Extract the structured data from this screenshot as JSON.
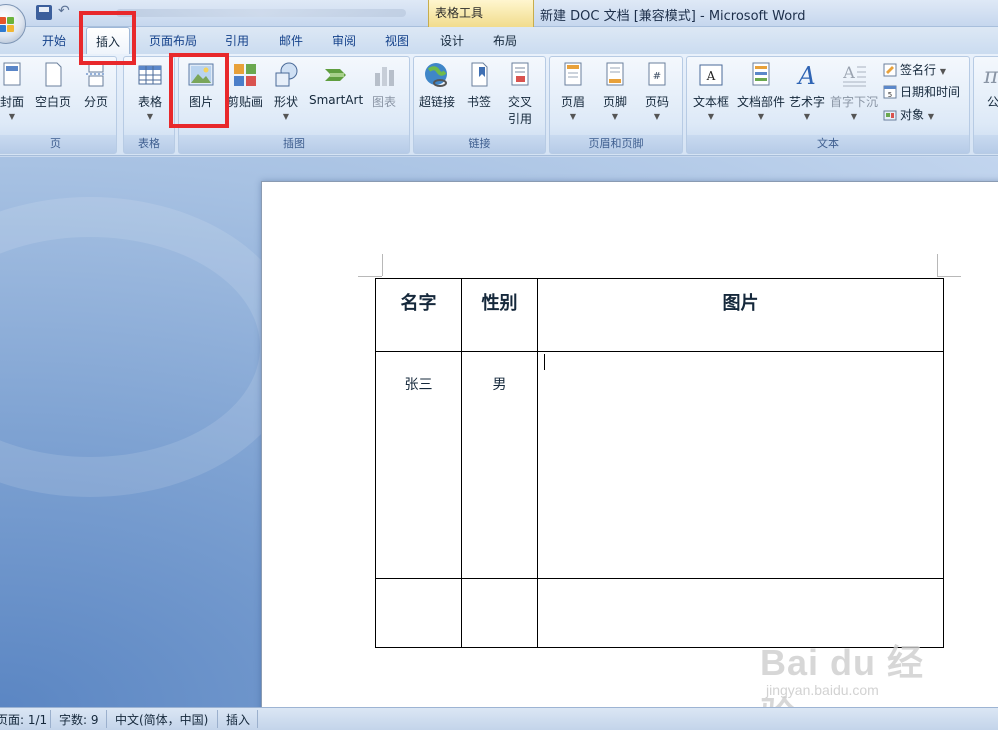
{
  "window": {
    "title": "新建 DOC 文档 [兼容模式] - Microsoft Word",
    "context_tool_label": "表格工具"
  },
  "tabs": [
    {
      "label": "开始"
    },
    {
      "label": "插入",
      "active": true
    },
    {
      "label": "页面布局"
    },
    {
      "label": "引用"
    },
    {
      "label": "邮件"
    },
    {
      "label": "审阅"
    },
    {
      "label": "视图"
    },
    {
      "label": "设计",
      "context": true
    },
    {
      "label": "布局",
      "context": true
    }
  ],
  "ribbon": {
    "groups": {
      "pages": {
        "label": "页",
        "buttons": [
          {
            "label": "封面",
            "icon": "cover-page-icon"
          },
          {
            "label": "空白页",
            "icon": "blank-page-icon"
          },
          {
            "label": "分页",
            "icon": "page-break-icon"
          }
        ]
      },
      "tables": {
        "label": "表格",
        "buttons": [
          {
            "label": "表格",
            "icon": "table-icon"
          }
        ]
      },
      "illustrations": {
        "label": "插图",
        "buttons": [
          {
            "label": "图片",
            "icon": "picture-icon"
          },
          {
            "label": "剪贴画",
            "icon": "clip-art-icon"
          },
          {
            "label": "形状",
            "icon": "shapes-icon"
          },
          {
            "label": "SmartArt",
            "icon": "smartart-icon"
          },
          {
            "label": "图表",
            "icon": "chart-icon",
            "disabled": true
          }
        ]
      },
      "links": {
        "label": "链接",
        "buttons": [
          {
            "label": "超链接",
            "icon": "hyperlink-icon"
          },
          {
            "label": "书签",
            "icon": "bookmark-icon"
          },
          {
            "label": "交叉",
            "label2": "引用",
            "icon": "cross-reference-icon"
          }
        ]
      },
      "header_footer": {
        "label": "页眉和页脚",
        "buttons": [
          {
            "label": "页眉",
            "icon": "header-icon"
          },
          {
            "label": "页脚",
            "icon": "footer-icon"
          },
          {
            "label": "页码",
            "icon": "page-number-icon"
          }
        ]
      },
      "text": {
        "label": "文本",
        "buttons": [
          {
            "label": "文本框",
            "icon": "text-box-icon"
          },
          {
            "label": "文档部件",
            "icon": "quick-parts-icon"
          },
          {
            "label": "艺术字",
            "icon": "wordart-icon"
          },
          {
            "label": "首字下沉",
            "icon": "drop-cap-icon",
            "disabled": true
          }
        ],
        "small_buttons": [
          {
            "label": "签名行",
            "icon": "signature-line-icon"
          },
          {
            "label": "日期和时间",
            "icon": "date-time-icon"
          },
          {
            "label": "对象",
            "icon": "object-icon"
          }
        ]
      },
      "symbols": {
        "buttons": [
          {
            "label": "公",
            "icon": "equation-icon"
          }
        ]
      }
    }
  },
  "document": {
    "table": {
      "headers": [
        "名字",
        "性别",
        "图片"
      ],
      "rows": [
        [
          "张三",
          "男",
          ""
        ],
        [
          "",
          "",
          ""
        ]
      ]
    }
  },
  "statusbar": {
    "page": "页面: 1/1",
    "words": "字数: 9",
    "language": "中文(简体，中国)",
    "mode": "插入"
  },
  "watermark": {
    "main": "Bai du 经验",
    "sub": "jingyan.baidu.com"
  },
  "colors": {
    "highlight": "#e8282b",
    "ribbon_text": "#15428b"
  }
}
